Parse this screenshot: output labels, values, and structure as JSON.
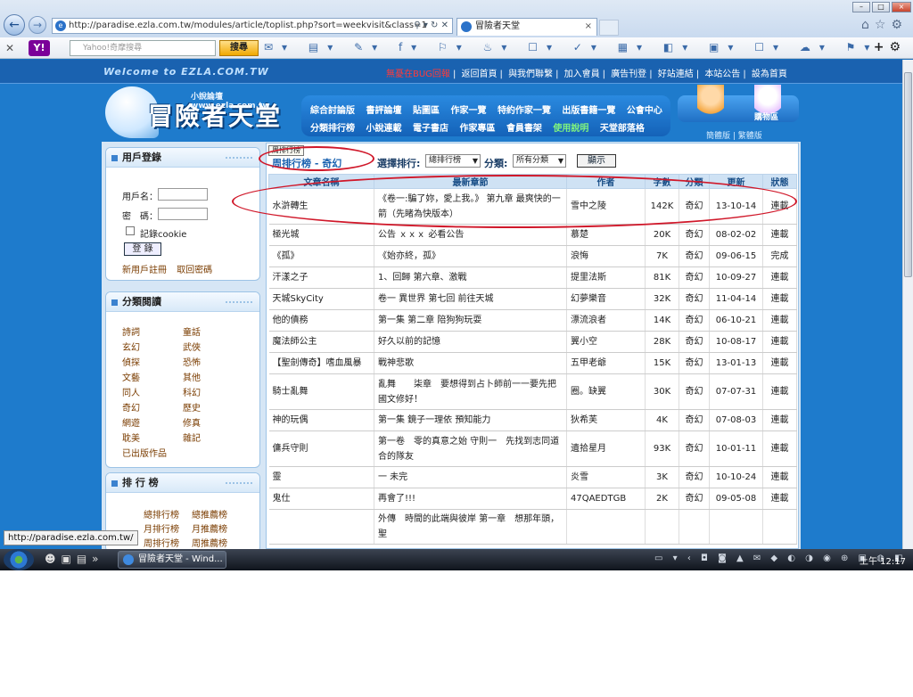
{
  "browser": {
    "url": "http://paradise.ezla.com.tw/modules/article/toplist.php?sort=weekvisit&class=1",
    "tab_title": "冒險者天堂",
    "ie_icon_text": "e"
  },
  "yahoo_toolbar": {
    "search_placeholder": "Yahoo!奇摩搜尋",
    "search_button": "搜尋"
  },
  "site": {
    "welcome": "Welcome to EZLA.COM.TW",
    "top_menu": [
      "無憂在BUG回報",
      "返回首頁",
      "與我們聯繫",
      "加入會員",
      "廣告刊登",
      "好站連結",
      "本站公告",
      "設為首頁"
    ],
    "logo_name": "冒險者天堂",
    "logo_sub": "小說論壇 www.ezla.com.tw",
    "nav_row1": [
      "綜合討論版",
      "書評論壇",
      "貼圖區",
      "作家一覽",
      "特約作家一覽",
      "出版書籍一覽",
      "公會中心"
    ],
    "nav_row2": [
      "分類排行榜",
      "小說連載",
      "電子書店",
      "作家專區",
      "會員書架",
      "使用說明",
      "天堂部落格"
    ],
    "shop_label": "購物區",
    "lang_links": "簡體版 | 繁體版"
  },
  "sidebar": {
    "login": {
      "title": "用戶登錄",
      "username_label": "用戶名：",
      "password_label": "密　碼：",
      "remember_label": "記錄cookie",
      "login_button": "登 錄",
      "register_link": "新用戶註冊",
      "forgot_link": "取回密碼"
    },
    "categories": {
      "title": "分類閱讀",
      "items": [
        "詩詞",
        "童話",
        "玄幻",
        "武俠",
        "偵探",
        "恐怖",
        "文藝",
        "其他",
        "同人",
        "科幻",
        "奇幻",
        "歷史",
        "網遊",
        "修真",
        "耽美",
        "雜記",
        "已出版作品"
      ]
    },
    "rank": {
      "title": "排 行 榜",
      "items": [
        "總排行榜",
        "總推薦榜",
        "月排行榜",
        "月推薦榜",
        "周排行榜",
        "周推薦榜"
      ]
    }
  },
  "main": {
    "mini_tooltip": "周排行榜",
    "heading": "周排行榜 - 奇幻",
    "select_label": "選擇排行:",
    "select_value": "總排行榜",
    "category_label": "分類:",
    "category_value": "所有分類",
    "show_button": "顯示",
    "columns": [
      "文章名稱",
      "最新章節",
      "作者",
      "字數",
      "分類",
      "更新",
      "狀態"
    ],
    "rows": [
      [
        "水滸轉生",
        "《卷一:騙了妳，愛上我。》 第九章 最爽快的一箭（先睹為快版本）",
        "雪中之陵",
        "142K",
        "奇幻",
        "13-10-14",
        "連載"
      ],
      [
        "極光城",
        "公告 ｘｘｘ 必看公告",
        "慕楚",
        "20K",
        "奇幻",
        "08-02-02",
        "連載"
      ],
      [
        "《孤》",
        "《始亦終，孤》",
        "浪悔",
        "7K",
        "奇幻",
        "09-06-15",
        "完成"
      ],
      [
        "汗漾之子",
        "1、回歸 第六章、激戰",
        "提里法斯",
        "81K",
        "奇幻",
        "10-09-27",
        "連載"
      ],
      [
        "天城SkyCity",
        "卷一 異世界 第七回 前往天城",
        "幻夢樂音",
        "32K",
        "奇幻",
        "11-04-14",
        "連載"
      ],
      [
        "他的債務",
        "第一集 第二章 陪狗狗玩耍",
        "漂流浪者",
        "14K",
        "奇幻",
        "06-10-21",
        "連載"
      ],
      [
        "魔法師公主",
        "好久以前的記憶",
        "翼小空",
        "28K",
        "奇幻",
        "10-08-17",
        "連載"
      ],
      [
        "【聖劍傳奇】嗜血風暴",
        "戰神悲歌",
        "五甲老爺",
        "15K",
        "奇幻",
        "13-01-13",
        "連載"
      ],
      [
        "騎士亂舞",
        "亂舞　　柒章　要想得到占卜師前一一要先把國文修好！",
        "圈。缺翼",
        "30K",
        "奇幻",
        "07-07-31",
        "連載"
      ],
      [
        "神的玩偶",
        "第一集 鏡子一理依 預知能力",
        "狄希芙",
        "4K",
        "奇幻",
        "07-08-03",
        "連載"
      ],
      [
        "傭兵守則",
        "第一卷　零的真意之始 守則一　先找到志同道合的隊友",
        "遺拾星月",
        "93K",
        "奇幻",
        "10-01-11",
        "連載"
      ],
      [
        "靈",
        "一 未完",
        "炎雪",
        "3K",
        "奇幻",
        "10-10-24",
        "連載"
      ],
      [
        "鬼仕",
        "再會了!!!",
        "47QAEDTGB",
        "2K",
        "奇幻",
        "09-05-08",
        "連載"
      ],
      [
        "",
        "外傳　時間的此端與彼岸 第一章　想那年頭，聖",
        "",
        "",
        "",
        "",
        ""
      ]
    ]
  },
  "status_url": "http://paradise.ezla.com.tw/",
  "taskbar": {
    "task_label": "冒險者天堂 - Wind...",
    "clock": "上午 12:17"
  },
  "colors": {
    "page_blue": "#1e7bcc",
    "highlight_red": "#d0182a",
    "header_blue": "#cfe2f4"
  }
}
